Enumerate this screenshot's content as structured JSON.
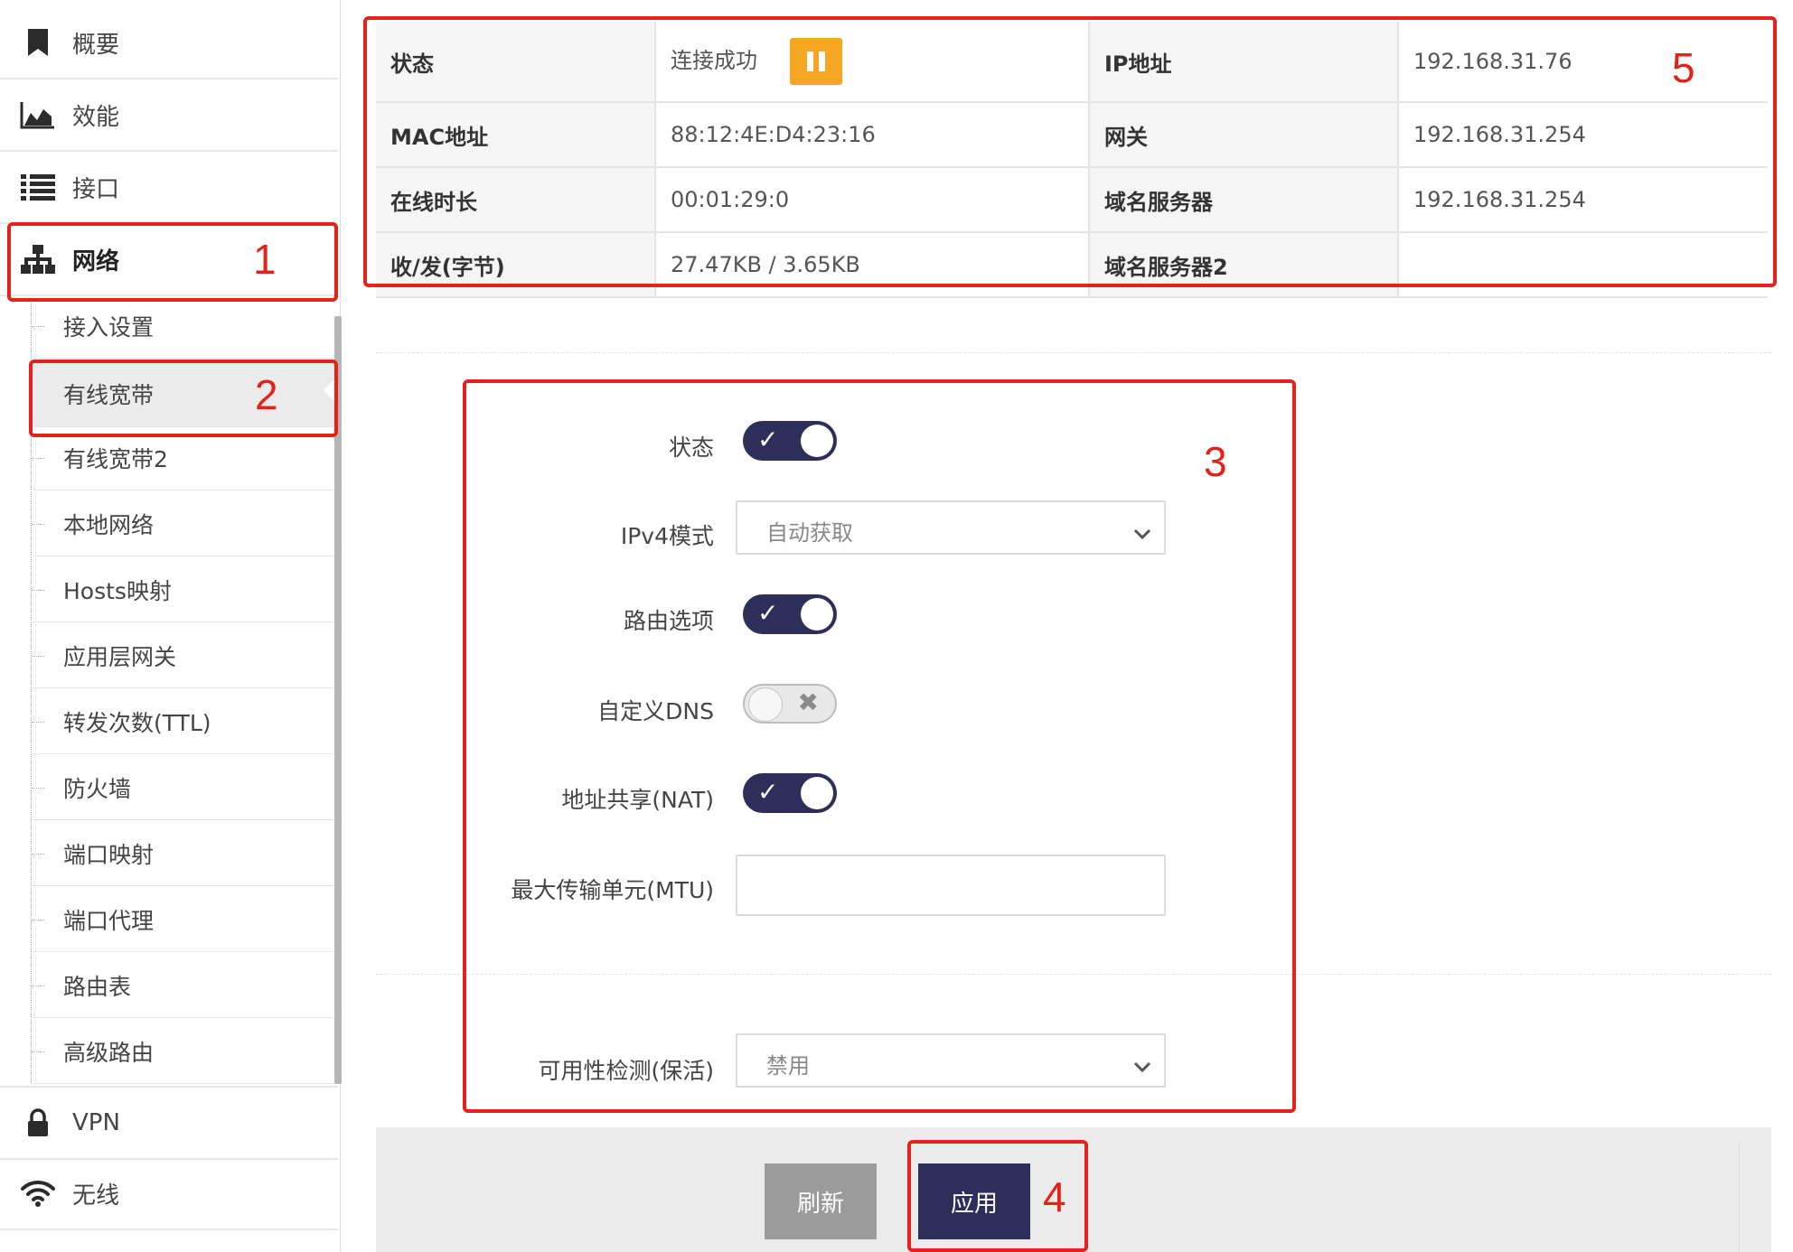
{
  "sidebar": {
    "top_items": [
      {
        "label": "概要",
        "icon": "bookmark-icon"
      },
      {
        "label": "效能",
        "icon": "area-chart-icon"
      },
      {
        "label": "接口",
        "icon": "list-icon"
      },
      {
        "label": "网络",
        "icon": "sitemap-icon"
      }
    ],
    "sub_items": [
      {
        "label": "接入设置"
      },
      {
        "label": "有线宽带"
      },
      {
        "label": "有线宽带2"
      },
      {
        "label": "本地网络"
      },
      {
        "label": "Hosts映射"
      },
      {
        "label": "应用层网关"
      },
      {
        "label": "转发次数(TTL)"
      },
      {
        "label": "防火墙"
      },
      {
        "label": "端口映射"
      },
      {
        "label": "端口代理"
      },
      {
        "label": "路由表"
      },
      {
        "label": "高级路由"
      }
    ],
    "bottom_items": [
      {
        "label": "VPN",
        "icon": "lock-icon"
      },
      {
        "label": "无线",
        "icon": "wifi-icon"
      }
    ],
    "active_top": "网络",
    "active_sub": "有线宽带"
  },
  "status": {
    "rows": [
      {
        "k1": "状态",
        "v1": "连接成功",
        "k2": "IP地址",
        "v2": "192.168.31.76"
      },
      {
        "k1": "MAC地址",
        "v1": "88:12:4E:D4:23:16",
        "k2": "网关",
        "v2": "192.168.31.254"
      },
      {
        "k1": "在线时长",
        "v1": "00:01:29:0",
        "k2": "域名服务器",
        "v2": "192.168.31.254"
      },
      {
        "k1": "收/发(字节)",
        "v1": "27.47KB / 3.65KB",
        "k2": "域名服务器2",
        "v2": ""
      }
    ]
  },
  "form": {
    "status_label": "状态",
    "status_on": true,
    "ipv4_label": "IPv4模式",
    "ipv4_value": "自动获取",
    "route_label": "路由选项",
    "route_on": true,
    "dns_label": "自定义DNS",
    "dns_on": false,
    "nat_label": "地址共享(NAT)",
    "nat_on": true,
    "mtu_label": "最大传输单元(MTU)",
    "mtu_value": "",
    "keepalive_label": "可用性检测(保活)",
    "keepalive_value": "禁用"
  },
  "buttons": {
    "refresh": "刷新",
    "apply": "应用"
  },
  "annotations": [
    "1",
    "2",
    "3",
    "4",
    "5"
  ],
  "colors": {
    "accent": "#2d2f5a",
    "annotation": "#e32219",
    "pause": "#f5a623",
    "refresh_bg": "#9b9b9b"
  }
}
